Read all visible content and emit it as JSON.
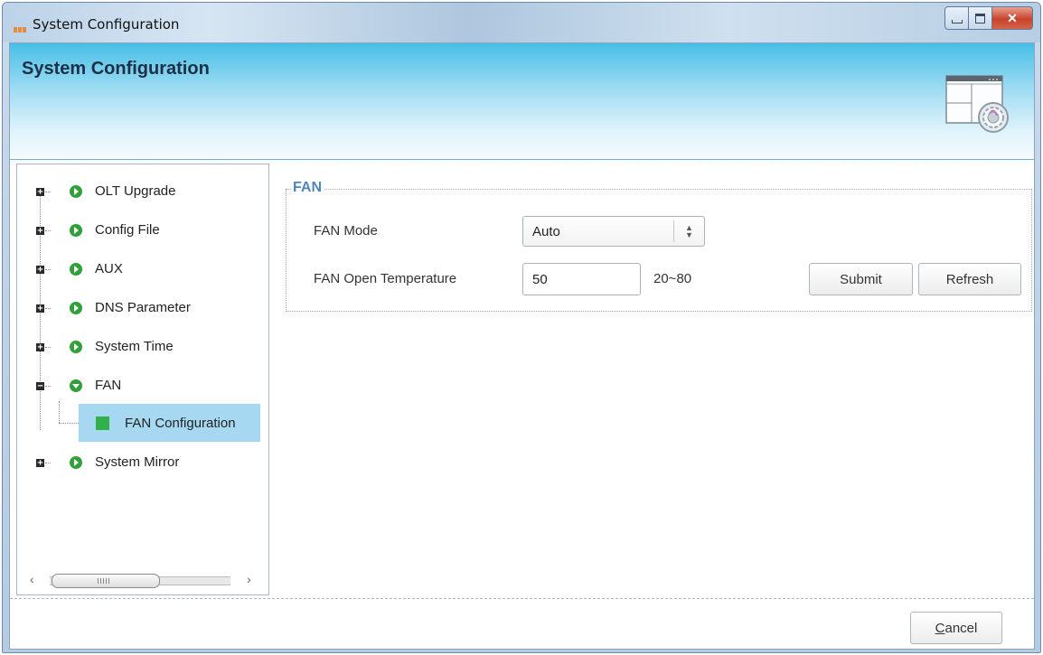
{
  "window": {
    "title": "System Configuration",
    "controls": [
      "minimize",
      "maximize",
      "close"
    ]
  },
  "header": {
    "title": "System Configuration",
    "icon": "system-config-gear-icon"
  },
  "tree": {
    "items": [
      {
        "label": "OLT Upgrade",
        "expanded": false
      },
      {
        "label": "Config File",
        "expanded": false
      },
      {
        "label": "AUX",
        "expanded": false
      },
      {
        "label": "DNS Parameter",
        "expanded": false
      },
      {
        "label": "System Time",
        "expanded": false
      },
      {
        "label": "FAN",
        "expanded": true,
        "children": [
          {
            "label": "FAN Configuration",
            "selected": true
          }
        ]
      },
      {
        "label": "System Mirror",
        "expanded": false
      }
    ],
    "selected_label": "FAN Configuration"
  },
  "fan": {
    "group_title": "FAN",
    "mode_label": "FAN Mode",
    "mode_value": "Auto",
    "temp_label": "FAN Open Temperature",
    "temp_value": "50",
    "temp_range": "20~80",
    "submit_label": "Submit",
    "refresh_label": "Refresh"
  },
  "footer": {
    "cancel_label": "Cancel",
    "cancel_rest": "ancel",
    "cancel_mnemonic": "C"
  },
  "colors": {
    "accent": "#4f86bd",
    "selection": "#a6d9f1",
    "node_green": "#2fa03a",
    "banner_top": "#47bfe6"
  }
}
